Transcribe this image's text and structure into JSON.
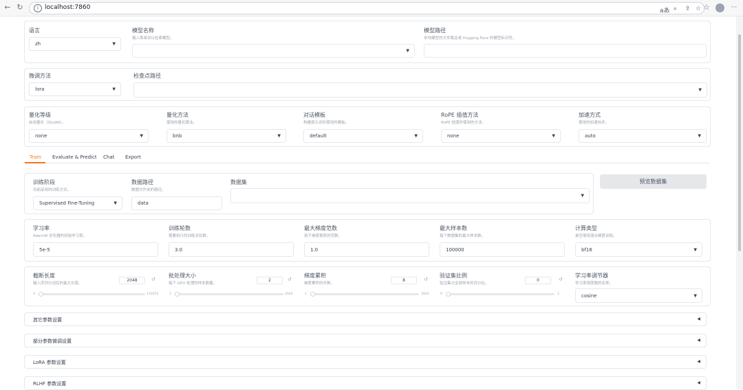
{
  "browser": {
    "url": "localhost:7860",
    "reader_label": "aあ",
    "menu_label": "···"
  },
  "top": {
    "lang": {
      "label": "语言",
      "value": "zh"
    },
    "model_name": {
      "label": "模型名称",
      "info": "输入首单词以检索模型。"
    },
    "model_path": {
      "label": "模型路径",
      "info": "本地模型的文件路径或 Hugging Face 的模型标识符。"
    },
    "finetuning_type": {
      "label": "微调方法",
      "value": "lora"
    },
    "checkpoint_path": {
      "label": "检查点路径"
    },
    "quantization_bit": {
      "label": "量化等级",
      "info": "启用量化（QLoRA）。",
      "value": "none"
    },
    "quantization_method": {
      "label": "量化方法",
      "info": "使用的量化算法。",
      "value": "bnb"
    },
    "template": {
      "label": "对话模板",
      "info": "构建提示词时使用的模板。",
      "value": "default"
    },
    "rope_scaling": {
      "label": "RoPE 插值方法",
      "info": "RoPE 插值时使用的方法。",
      "value": "none"
    },
    "booster": {
      "label": "加速方式",
      "info": "使用的加速技术。",
      "value": "auto"
    }
  },
  "tabs": [
    "Train",
    "Evaluate & Predict",
    "Chat",
    "Export"
  ],
  "train": {
    "stage": {
      "label": "训练阶段",
      "info": "目前采用的训练方式。",
      "value": "Supervised Fine-Tuning"
    },
    "dataset_dir": {
      "label": "数据路径",
      "info": "数据文件夹的路径。",
      "value": "data"
    },
    "dataset": {
      "label": "数据集"
    },
    "preview_button": "预览数据集",
    "learning_rate": {
      "label": "学习率",
      "info": "AdamW 优化器的初始学习率。",
      "value": "5e-5"
    },
    "num_epochs": {
      "label": "训练轮数",
      "info": "需要执行的训练总轮数。",
      "value": "3.0"
    },
    "max_grad_norm": {
      "label": "最大梯度范数",
      "info": "用于梯度裁剪的范数。",
      "value": "1.0"
    },
    "max_samples": {
      "label": "最大样本数",
      "info": "每个数据集的最大样本数。",
      "value": "100000"
    },
    "compute_type": {
      "label": "计算类型",
      "info": "是否使用混合精度训练。",
      "value": "bf16"
    },
    "cutoff_len": {
      "label": "截断长度",
      "info": "输入序列分词后的最大长度。",
      "value": "2048",
      "min": "4",
      "max": "131072",
      "fraction": 0.016
    },
    "batch_size": {
      "label": "批处理大小",
      "info": "每个 GPU 处理的样本数量。",
      "value": "2",
      "min": "1",
      "max": "1024",
      "fraction": 0.001
    },
    "grad_accum": {
      "label": "梯度累积",
      "info": "梯度累积的步数。",
      "value": "8",
      "min": "1",
      "max": "1024",
      "fraction": 0.007
    },
    "val_size": {
      "label": "验证集比例",
      "info": "验证集占全部样本的百分比。",
      "value": "0",
      "min": "0",
      "max": "1",
      "fraction": 0.0
    },
    "lr_scheduler": {
      "label": "学习率调节器",
      "info": "学习率调度器的名称。",
      "value": "cosine"
    }
  },
  "accordions": [
    "其它参数设置",
    "部分参数微调设置",
    "LoRA 参数设置",
    "RLHF 参数设置"
  ],
  "icons": {
    "dropdown": "▼",
    "collapse": "◀",
    "reset": "↺"
  },
  "colors": {
    "accent": "#f97316"
  }
}
